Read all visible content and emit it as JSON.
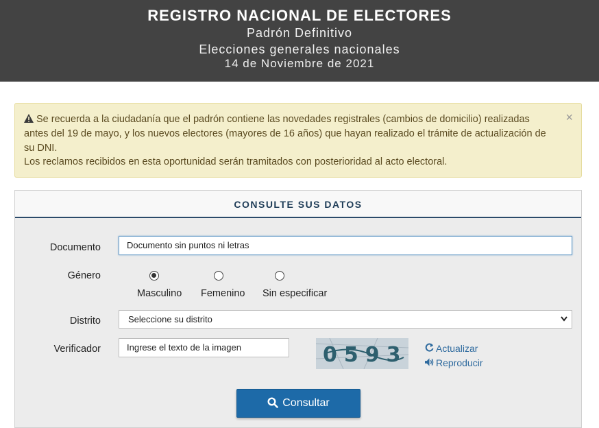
{
  "header": {
    "title": "REGISTRO NACIONAL DE ELECTORES",
    "subtitle1": "Padrón Definitivo",
    "subtitle2": "Elecciones generales nacionales",
    "date": "14 de Noviembre de 2021"
  },
  "alert": {
    "paragraph1": "Se recuerda a la ciudadanía que el padrón contiene las novedades registrales (cambios de domicilio) realizadas antes del 19 de mayo, y los nuevos electores (mayores de 16 años) que hayan realizado el trámite de actualización de su DNI.",
    "paragraph2": "Los reclamos recibidos en esta oportunidad serán tramitados con posterioridad al acto electoral.",
    "close_label": "×"
  },
  "form": {
    "heading": "CONSULTE SUS DATOS",
    "document_label": "Documento",
    "document_placeholder": "Documento sin puntos ni letras",
    "gender_label": "Género",
    "gender_options": [
      "Masculino",
      "Femenino",
      "Sin especificar"
    ],
    "gender_selected": "Masculino",
    "district_label": "Distrito",
    "district_selected": "Seleccione su distrito",
    "verifier_label": "Verificador",
    "verifier_placeholder": "Ingrese el texto de la imagen",
    "captcha_text": "0593",
    "refresh_label": "Actualizar",
    "play_label": "Reproducir",
    "submit_label": "Consultar"
  },
  "colors": {
    "header_bg": "#434343",
    "alert_bg": "#f4efcc",
    "panel_bg": "#ececec",
    "accent": "#1d6aa8",
    "link": "#2e6a9e"
  },
  "icons": [
    "warning-icon",
    "close-icon",
    "chevron-down-icon",
    "refresh-icon",
    "volume-icon",
    "search-icon"
  ]
}
